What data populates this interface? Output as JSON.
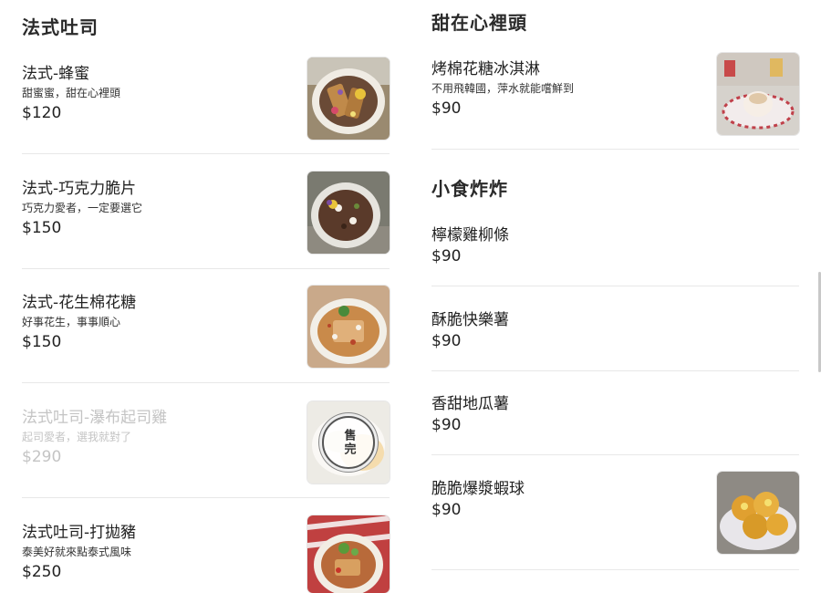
{
  "sections": {
    "french_toast": {
      "title": "法式吐司",
      "items": [
        {
          "name": "法式-蜂蜜",
          "desc": "甜蜜蜜，甜在心裡頭",
          "price": "$120"
        },
        {
          "name": "法式-巧克力脆片",
          "desc": "巧克力愛者，一定要選它",
          "price": "$150"
        },
        {
          "name": "法式-花生棉花糖",
          "desc": "好事花生，事事順心",
          "price": "$150"
        },
        {
          "name": "法式吐司-瀑布起司雞",
          "desc": "起司愛者，選我就對了",
          "price": "$290",
          "sold_out_label": "售完"
        },
        {
          "name": "法式吐司-打拋豬",
          "desc": "泰美好就來點泰式風味",
          "price": "$250"
        }
      ]
    },
    "dessert": {
      "title": "甜在心裡頭",
      "items": [
        {
          "name": "烤棉花糖冰淇淋",
          "desc": "不用飛韓國，萍水就能嚐鮮到",
          "price": "$90"
        }
      ]
    },
    "snacks": {
      "title": "小食炸炸",
      "items": [
        {
          "name": "檸檬雞柳條",
          "price": "$90"
        },
        {
          "name": "酥脆快樂薯",
          "price": "$90"
        },
        {
          "name": "香甜地瓜薯",
          "price": "$90"
        },
        {
          "name": "脆脆爆漿蝦球",
          "price": "$90"
        }
      ]
    }
  },
  "icons": {
    "thumb_honey": "honey-toast-photo",
    "thumb_choco": "chocolate-toast-photo",
    "thumb_peanut": "peanut-toast-photo",
    "thumb_cheese": "cheese-chicken-toast-photo",
    "thumb_pork": "basil-pork-toast-photo",
    "thumb_icecream": "marshmallow-icecream-photo",
    "thumb_shrimp": "shrimp-ball-photo"
  }
}
